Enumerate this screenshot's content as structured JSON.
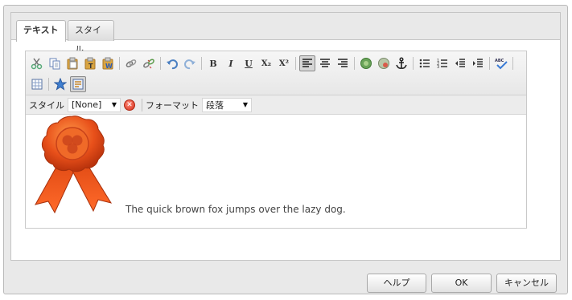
{
  "tabs": [
    {
      "label": "テキスト",
      "active": true
    },
    {
      "label": "スタイル",
      "active": false
    }
  ],
  "toolbar": {
    "row1": [
      "cut-icon",
      "copy-icon",
      "paste-icon",
      "paste-text-icon",
      "paste-word-icon",
      "link-icon",
      "unlink-icon",
      "undo-icon",
      "redo-icon",
      "bold",
      "italic",
      "underline",
      "subscript",
      "superscript",
      "align-left-icon",
      "align-center-icon",
      "align-right-icon",
      "image-icon",
      "image-properties-icon",
      "anchor-icon",
      "bullet-list-icon",
      "numbered-list-icon",
      "outdent-icon",
      "indent-icon",
      "spellcheck-icon"
    ],
    "row2": [
      "table-icon",
      "special-char-icon",
      "source-edit-icon"
    ],
    "bold_label": "B",
    "italic_label": "I",
    "underline_label": "U",
    "subscript_label": "X₂",
    "superscript_label": "X²",
    "spellcheck_label": "ABC"
  },
  "stylebar": {
    "style_label": "スタイル",
    "style_value": "[None]",
    "format_label": "フォーマット",
    "format_value": "段落"
  },
  "content": {
    "text": "The quick brown fox jumps over the lazy dog."
  },
  "buttons": {
    "help": "ヘルプ",
    "ok": "OK",
    "cancel": "キャンセル"
  }
}
